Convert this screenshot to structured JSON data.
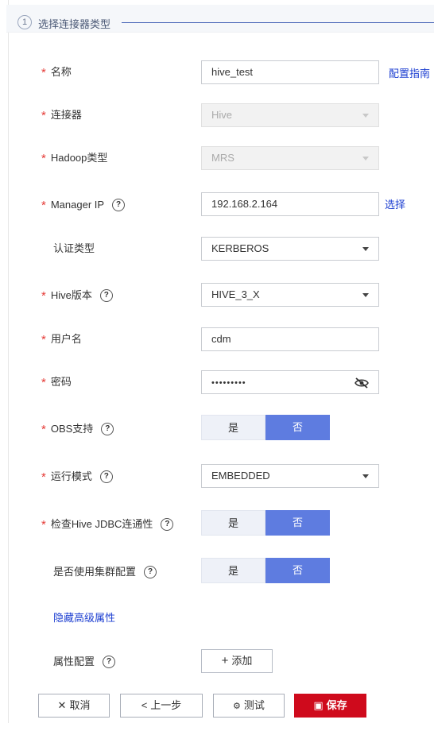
{
  "step": {
    "number": "1",
    "title": "选择连接器类型"
  },
  "required_mark": "*",
  "help_glyph": "?",
  "form": {
    "name": {
      "label": "名称",
      "value": "hive_test",
      "link": "配置指南"
    },
    "connector": {
      "label": "连接器",
      "value": "Hive"
    },
    "hadoop_type": {
      "label": "Hadoop类型",
      "value": "MRS"
    },
    "manager_ip": {
      "label": "Manager IP",
      "value": "192.168.2.164",
      "link": "选择"
    },
    "auth_type": {
      "label": "认证类型",
      "value": "KERBEROS"
    },
    "hive_version": {
      "label": "Hive版本",
      "value": "HIVE_3_X"
    },
    "username": {
      "label": "用户名",
      "value": "cdm"
    },
    "password": {
      "label": "密码",
      "value": "•••••••••"
    },
    "obs_support": {
      "label": "OBS支持",
      "yes": "是",
      "no": "否",
      "selected": "否"
    },
    "run_mode": {
      "label": "运行模式",
      "value": "EMBEDDED"
    },
    "check_jdbc": {
      "label": "检查Hive JDBC连通性",
      "yes": "是",
      "no": "否",
      "selected": "否"
    },
    "use_cluster_config": {
      "label": "是否使用集群配置",
      "yes": "是",
      "no": "否",
      "selected": "否"
    },
    "hide_advanced": "隐藏高级属性",
    "property_config": {
      "label": "属性配置",
      "add_button": "添加"
    }
  },
  "footer": {
    "cancel": "取消",
    "prev": "上一步",
    "test": "测试",
    "save": "保存"
  },
  "colors": {
    "required": "#e53935",
    "link": "#1d3fd1",
    "toggle_on": "#5e7ce0",
    "save": "#cf0a1c"
  },
  "icons": [
    "eye-off-icon",
    "caret-down-icon",
    "help-icon",
    "plus-icon",
    "close-icon",
    "chevron-left-icon",
    "test-icon",
    "save-icon"
  ]
}
